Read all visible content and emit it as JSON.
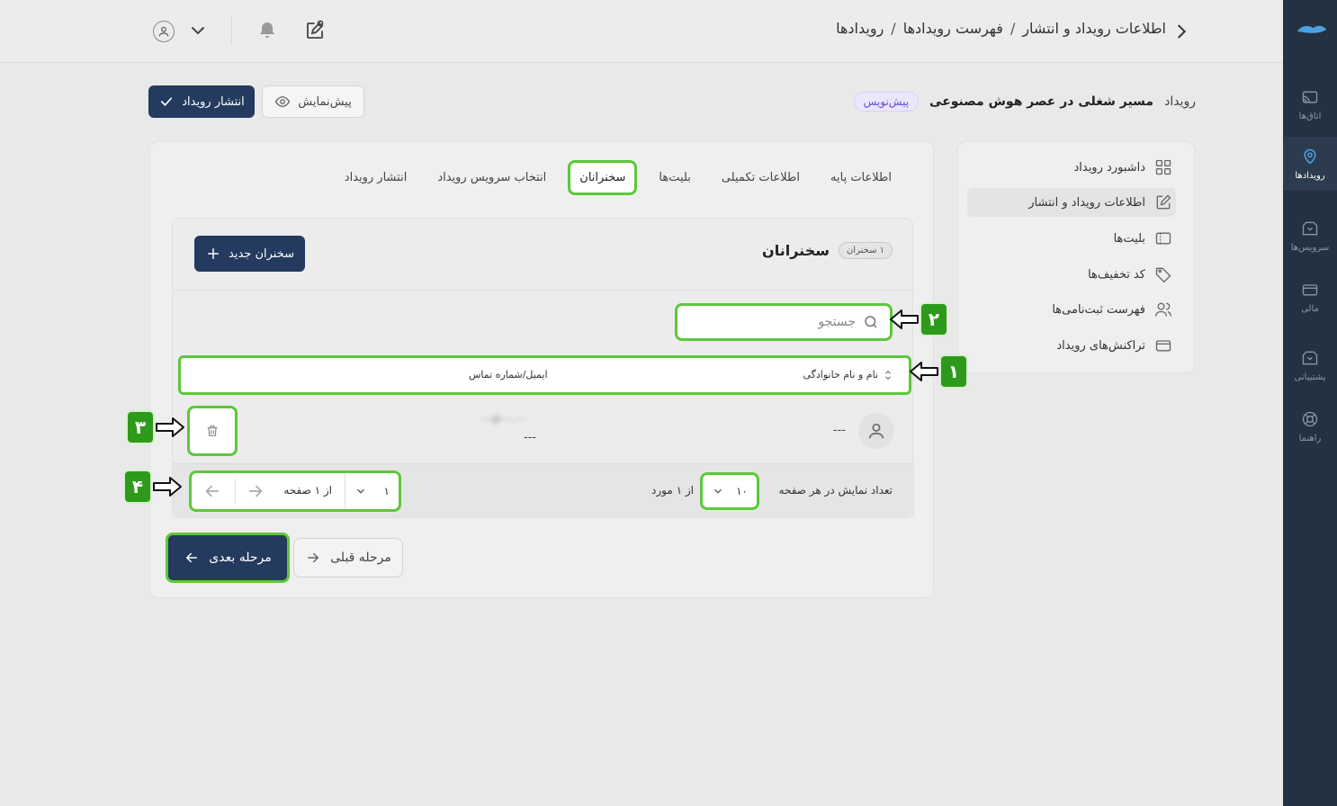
{
  "colors": {
    "rail": "#243142",
    "primary": "#243a5e",
    "highlight": "#5cc83a",
    "callout": "#2e9a1c",
    "draft_badge": "#6a4bd6"
  },
  "rail": {
    "items": [
      {
        "label": "اتاق‌ها",
        "icon": "cast-icon"
      },
      {
        "label": "رویدادها",
        "icon": "location-pin-icon"
      },
      {
        "label": "سرویس‌ها",
        "icon": "box-icon"
      },
      {
        "label": "مالی",
        "icon": "credit-card-icon"
      },
      {
        "label": "پشتیبانی",
        "icon": "support-box-icon"
      },
      {
        "label": "راهنما",
        "icon": "lifebuoy-icon"
      }
    ]
  },
  "topbar": {
    "breadcrumb": [
      "رویدادها",
      "فهرست رویدادها",
      "اطلاعات رویداد و انتشار"
    ],
    "separator": "/"
  },
  "header": {
    "event_label": "رویداد",
    "event_name": "مسیر شغلی در عصر هوش مصنوعی",
    "status": "پیش‌نویس",
    "preview_label": "پیش‌نمایش",
    "publish_label": "انتشار رویداد"
  },
  "side_menu": {
    "items": [
      {
        "label": "داشبورد رویداد",
        "icon": "grid-icon"
      },
      {
        "label": "اطلاعات رویداد و انتشار",
        "icon": "edit-icon"
      },
      {
        "label": "بلیت‌ها",
        "icon": "ticket-icon"
      },
      {
        "label": "کد تخفیف‌ها",
        "icon": "tag-icon"
      },
      {
        "label": "فهرست ثبت‌نامی‌ها",
        "icon": "users-icon"
      },
      {
        "label": "تراکنش‌های رویداد",
        "icon": "card-icon"
      }
    ]
  },
  "tabs": [
    "اطلاعات پایه",
    "اطلاعات تکمیلی",
    "بلیت‌ها",
    "سخنرانان",
    "انتخاب سرویس رویداد",
    "انتشار رویداد"
  ],
  "speakers": {
    "title": "سخنرانان",
    "count_badge": "۱ سخنران",
    "new_button": "سخنران جدید",
    "search_placeholder": "جستجو",
    "columns": {
      "name": "نام و نام خانوادگی",
      "email": "ایمیل/شماره تماس"
    },
    "rows": [
      {
        "name": "---",
        "email_blurred": "---@---.---",
        "email": "---"
      }
    ]
  },
  "pagination": {
    "per_page_label": "تعداد نمایش در هر صفحه",
    "per_page_value": "۱۰",
    "of_items": "از ۱ مورد",
    "page_value": "۱",
    "of_pages": "از ۱ صفحه"
  },
  "footer": {
    "next_label": "مرحله بعدی",
    "prev_label": "مرحله قبلی"
  },
  "callouts": [
    "۱",
    "۲",
    "۳",
    "۴"
  ]
}
